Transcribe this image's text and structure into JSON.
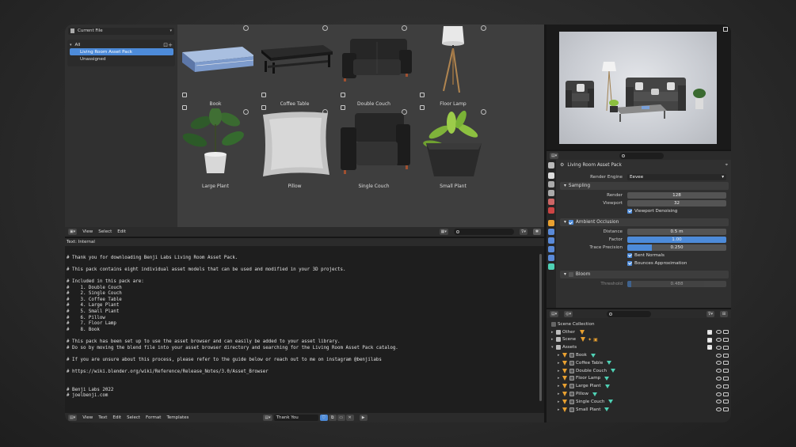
{
  "asset_browser": {
    "library_dropdown": "Current File",
    "tree": {
      "all": "All",
      "items": [
        "Living Room Asset Pack",
        "Unassigned"
      ]
    },
    "assets": [
      {
        "name": "Book"
      },
      {
        "name": "Coffee Table"
      },
      {
        "name": "Double Couch"
      },
      {
        "name": "Floor Lamp"
      },
      {
        "name": "Large Plant"
      },
      {
        "name": "Pillow"
      },
      {
        "name": "Single Couch"
      },
      {
        "name": "Small Plant"
      }
    ],
    "footer_menus": [
      "View",
      "Select",
      "Edit"
    ]
  },
  "text_editor": {
    "header": "Text: Internal",
    "lines": [
      "",
      "# Thank you for downloading Benji Labs Living Room Asset Pack.",
      "",
      "# This pack contains eight individual asset models that can be used and modified in your 3D projects.",
      "",
      "# Included in this pack are:",
      "#    1. Double Couch",
      "#    2. Single Couch",
      "#    3. Coffee Table",
      "#    4. Large Plant",
      "#    5. Small Plant",
      "#    6. Pillow",
      "#    7. Floor Lamp",
      "#    8. Book",
      "",
      "# This pack has been set up to use the asset browser and can easily be added to your asset library.",
      "# Do so by moving the blend file into your asset browser directory and searching for the Living Room Asset Pack catalog.",
      "",
      "# If you are unsure about this process, please refer to the guide below or reach out to me on instagram @benjilabs",
      "",
      "# https://wiki.blender.org/wiki/Reference/Release_Notes/3.0/Asset_Browser",
      "",
      "",
      "# Benji Labs 2022",
      "# joelbenji.com"
    ],
    "footer_menus": [
      "View",
      "Text",
      "Edit",
      "Select",
      "Format",
      "Templates"
    ],
    "text_name": "Thank You"
  },
  "properties": {
    "scene_name": "Living Room Asset Pack",
    "render_engine_label": "Render Engine",
    "render_engine": "Eevee",
    "sampling": {
      "title": "Sampling",
      "render_label": "Render",
      "render": "128",
      "viewport_label": "Viewport",
      "viewport": "32",
      "denoise": "Viewport Denoising"
    },
    "ao": {
      "title": "Ambient Occlusion",
      "distance_label": "Distance",
      "distance": "0.5 m",
      "factor_label": "Factor",
      "factor": "1.00",
      "precision_label": "Trace Precision",
      "precision": "0.250",
      "bent_normals": "Bent Normals",
      "bounces": "Bounces Approximation"
    },
    "bloom": {
      "title": "Bloom",
      "threshold_label": "Threshold",
      "threshold": "0.488"
    }
  },
  "outliner": {
    "root": "Scene Collection",
    "collections": [
      "Other",
      "Scene",
      "Assets"
    ],
    "objects": [
      "Book",
      "Coffee Table",
      "Double Couch",
      "Floor Lamp",
      "Large Plant",
      "Pillow",
      "Single Couch",
      "Small Plant"
    ]
  },
  "colors": {
    "accent_blue": "#4d8bd9",
    "collection_orange": "#e8a030",
    "mesh_teal": "#4fd1b5"
  }
}
